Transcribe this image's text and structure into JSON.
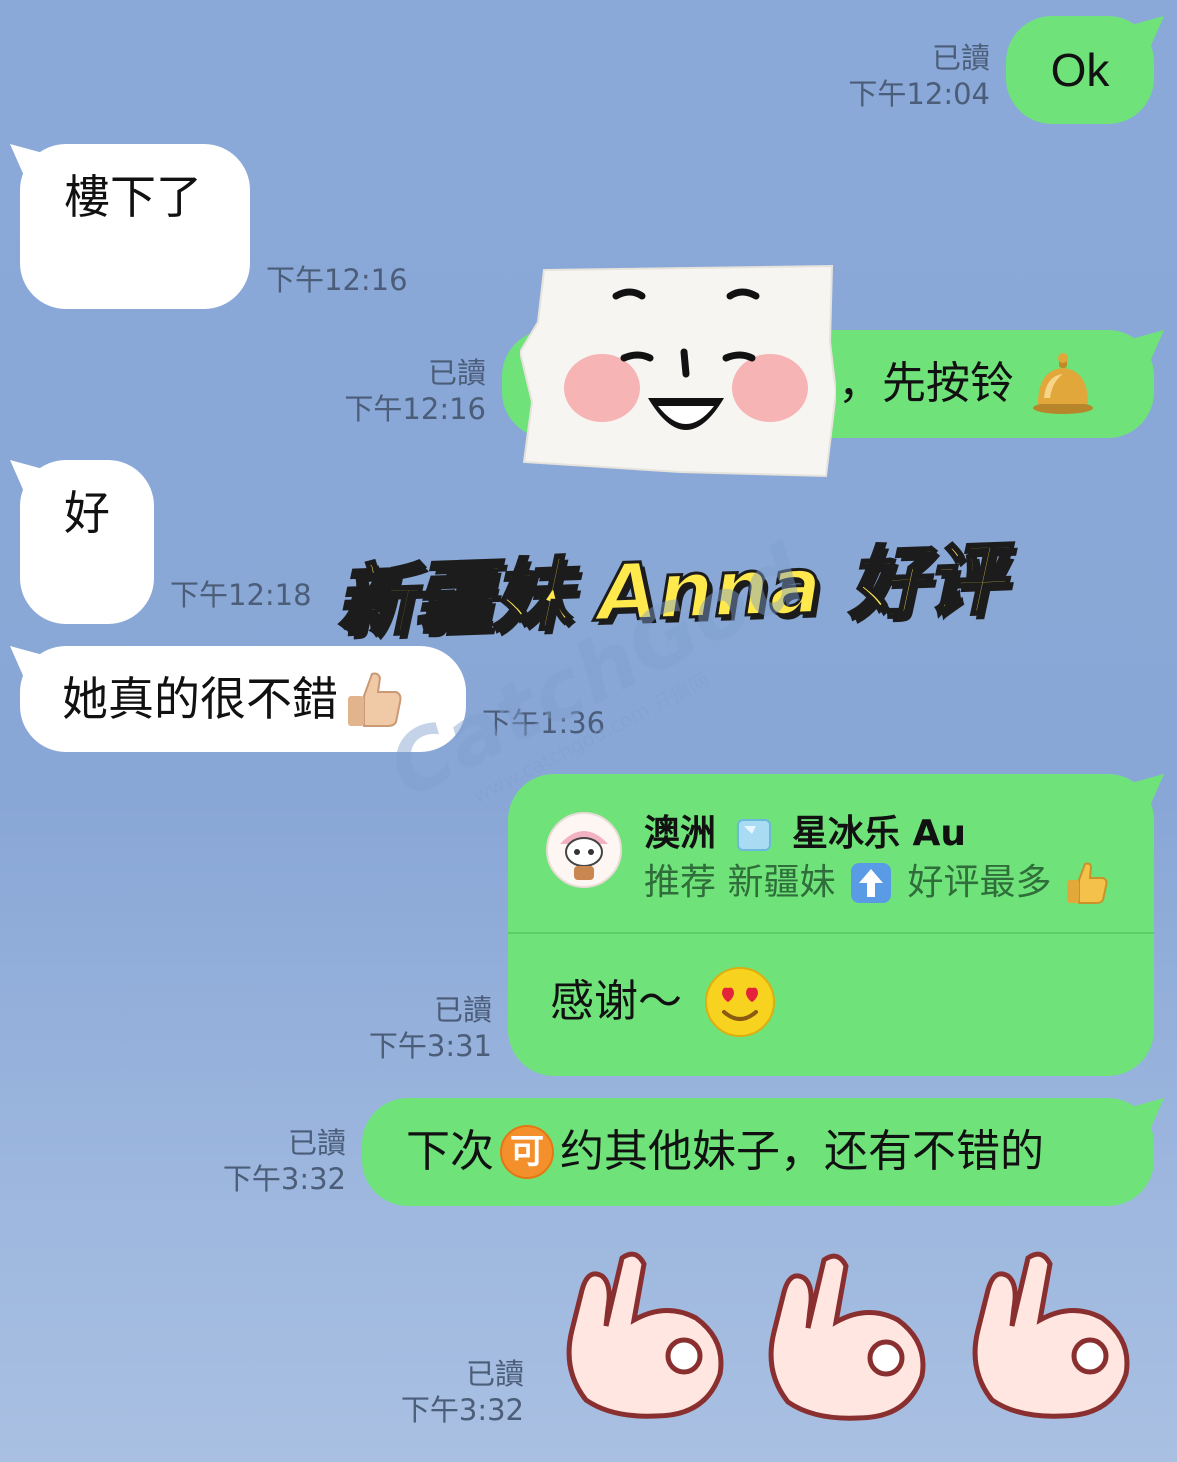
{
  "messages": {
    "m1": {
      "text": "Ok",
      "read": "已讀",
      "time": "下午12:04"
    },
    "m2": {
      "text": "樓下了",
      "time": "下午12:16"
    },
    "m3": {
      "text": "，先按铃",
      "read": "已讀",
      "time": "下午12:16"
    },
    "m4": {
      "text": "好",
      "time": "下午12:18"
    },
    "m5": {
      "text": "她真的很不錯",
      "time": "下午1:36"
    },
    "m6": {
      "quote_name_1": "澳洲",
      "quote_name_2": "星冰乐 Au",
      "quote_text_1": "推荐 新疆妹",
      "quote_text_2": "好评最多",
      "text": "感谢～",
      "read": "已讀",
      "time": "下午3:31"
    },
    "m7": {
      "text_before": "下次",
      "badge": "可",
      "text_after": "约其他妹子，还有不错的",
      "read": "已讀",
      "time": "下午3:32"
    },
    "m8": {
      "read": "已讀",
      "time": "下午3:32"
    }
  },
  "overlay": {
    "headline": "新疆妹 Anna 好评",
    "watermark_brand": "CatchGod",
    "watermark_site": "www.catchgod.com 开摘网"
  },
  "icons": [
    "bell-icon",
    "thumbs-up-icon",
    "ice-cube-icon",
    "up-arrow-icon",
    "heart-eyes-icon",
    "ok-hand-sticker",
    "face-sticker",
    "avatar"
  ],
  "colors": {
    "background": "#8aa9d8",
    "incoming_bubble": "#ffffff",
    "outgoing_bubble": "#6fe37a",
    "headline": "#ffe94d"
  }
}
